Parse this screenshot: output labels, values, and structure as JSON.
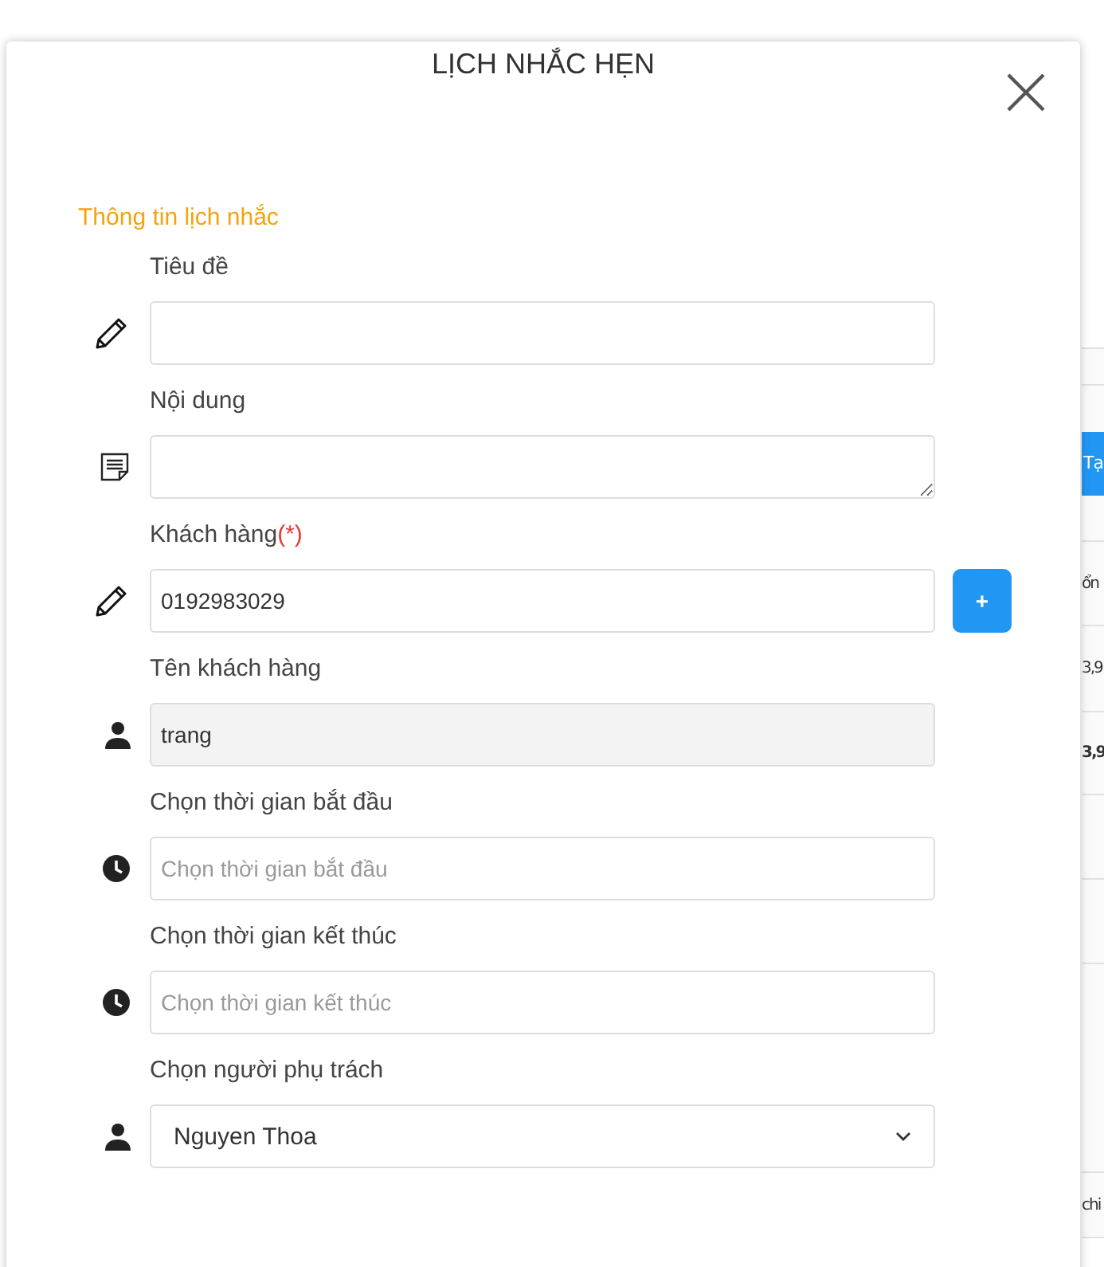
{
  "background": {
    "action_button": "Tạ",
    "cells": [
      "ổn",
      "3,9",
      "3,9",
      "chi"
    ]
  },
  "dialog": {
    "title": "LỊCH NHẮC HẸN",
    "section_title": "Thông tin lịch nhắc",
    "fields": [
      {
        "kind": "edit",
        "label": "Tiêu đề"
      },
      {
        "kind": "note",
        "label": "Nội dung"
      },
      {
        "kind": "lookup",
        "label": "Khách hàng",
        "required_mark": "(*)",
        "value": "0192983029",
        "add_button": "+"
      },
      {
        "kind": "person",
        "label": "Tên khách hàng",
        "value": "trang",
        "disabled": true
      },
      {
        "kind": "time",
        "label": "Chọn thời gian bắt đầu",
        "placeholder": "Chọn thời gian bắt đầu"
      },
      {
        "kind": "time",
        "label": "Chọn thời gian kết thúc",
        "placeholder": "Chọn thời gian kết thúc"
      },
      {
        "kind": "select",
        "label": "Chọn người phụ trách",
        "value": "Nguyen Thoa"
      }
    ]
  }
}
